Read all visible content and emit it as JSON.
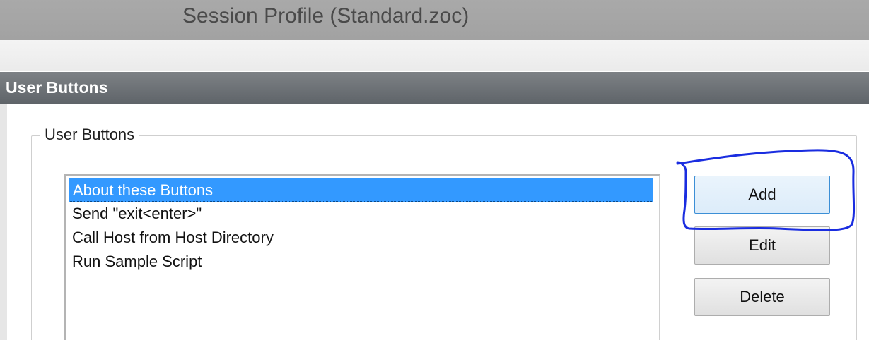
{
  "window": {
    "title": "Session Profile (Standard.zoc)"
  },
  "section": {
    "header": "User Buttons"
  },
  "group": {
    "legend": "User Buttons"
  },
  "list": {
    "items": [
      {
        "label": "About these Buttons",
        "selected": true
      },
      {
        "label": "Send \"exit<enter>\"",
        "selected": false
      },
      {
        "label": "Call Host from Host Directory",
        "selected": false
      },
      {
        "label": "Run Sample Script",
        "selected": false
      }
    ]
  },
  "buttons": {
    "add": "Add",
    "edit": "Edit",
    "delete": "Delete"
  },
  "colors": {
    "selection": "#3399ff",
    "header_bar": "#6b6f73",
    "annotation": "#1a2de0"
  },
  "annotation": {
    "shape": "hand-drawn circle around Add button",
    "icon": "pen-circle-annotation"
  }
}
